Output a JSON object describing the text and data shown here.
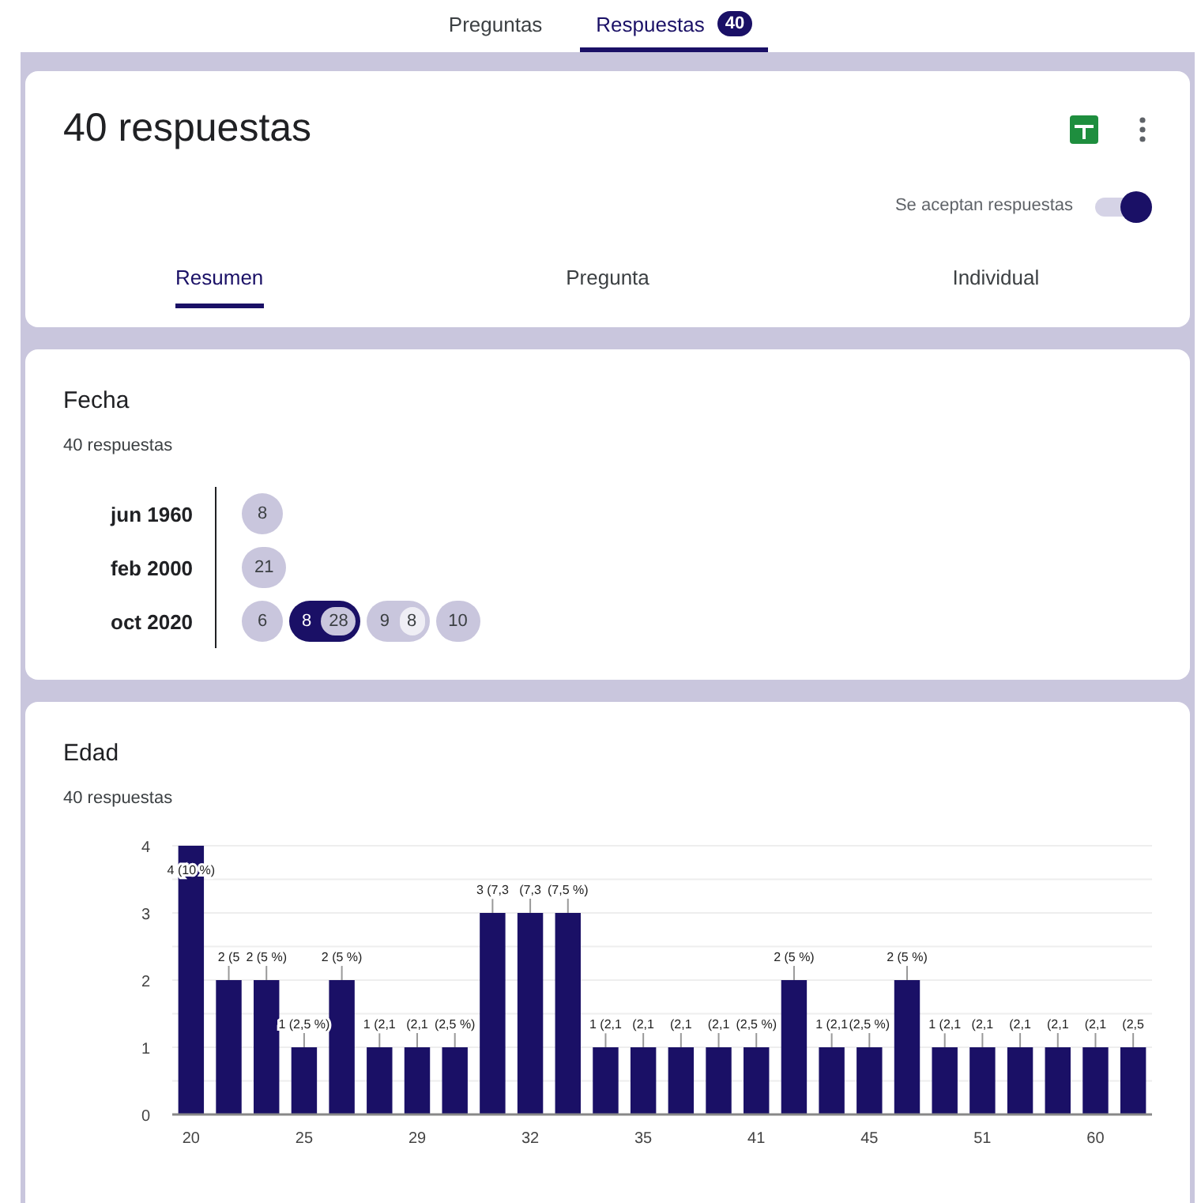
{
  "top_tabs": [
    {
      "label": "Preguntas",
      "selected": false
    },
    {
      "label": "Respuestas",
      "selected": true,
      "badge": "40"
    }
  ],
  "header": {
    "title": "40 respuestas",
    "accepting_label": "Se aceptan respuestas",
    "accepting_on": true
  },
  "summary_tabs": [
    {
      "label": "Resumen",
      "selected": true
    },
    {
      "label": "Pregunta",
      "selected": false
    },
    {
      "label": "Individual",
      "selected": false
    }
  ],
  "fecha": {
    "title": "Fecha",
    "count": "40 respuestas",
    "rows": [
      {
        "label": "jun 1960",
        "chips": [
          {
            "day": "8",
            "selected": false
          }
        ]
      },
      {
        "label": "feb 2000",
        "chips": [
          {
            "day": "21",
            "selected": false
          }
        ]
      },
      {
        "label": "oct 2020",
        "chips": [
          {
            "day": "6",
            "selected": false
          },
          {
            "day": "8",
            "count": "28",
            "selected": true
          },
          {
            "day": "9",
            "count": "8",
            "selected": false
          },
          {
            "day": "10",
            "selected": false
          }
        ]
      }
    ]
  },
  "edad": {
    "title": "Edad",
    "count": "40 respuestas",
    "chart_data": {
      "type": "bar",
      "ylim": [
        0,
        4
      ],
      "yticks": [
        0,
        1,
        2,
        3,
        4
      ],
      "grid": true,
      "categories": [
        "20",
        null,
        null,
        "25",
        null,
        null,
        "29",
        null,
        null,
        "32",
        null,
        null,
        "35",
        null,
        null,
        "41",
        null,
        null,
        "45",
        null,
        null,
        "51",
        null,
        null,
        "60",
        null
      ],
      "series": [
        {
          "color": "#1a1066",
          "values": [
            4,
            2,
            2,
            1,
            2,
            1,
            1,
            1,
            3,
            3,
            3,
            1,
            1,
            1,
            1,
            1,
            2,
            1,
            1,
            2,
            1,
            1,
            1,
            1,
            1,
            1
          ]
        }
      ],
      "value_labels": [
        "4 (10 %)",
        "2 (5",
        "2 (5 %)",
        "1 (2,5 %)",
        "2 (5 %)",
        "1 (2,1",
        "(2,1",
        "(2,5 %)",
        "3 (7,3",
        "(7,3",
        "(7,5 %)",
        "1 (2,1",
        "(2,1",
        "(2,1",
        "(2,1",
        "(2,5 %)",
        "2 (5 %)",
        "1 (2,1",
        "(2,5 %)",
        "2 (5 %)",
        "1 (2,1",
        "(2,1",
        "(2,1",
        "(2,1",
        "(2,1",
        "(2,5"
      ]
    }
  }
}
